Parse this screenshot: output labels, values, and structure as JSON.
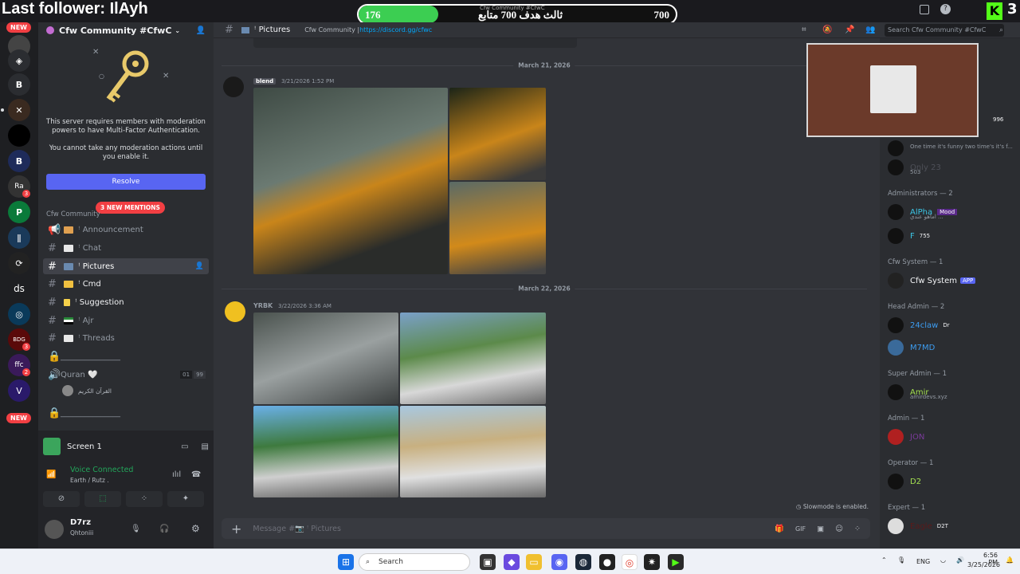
{
  "stream": {
    "last_follower": "Last follower: IlAyh",
    "goal_current": "176",
    "goal_target": "700",
    "goal_fraction": 0.25,
    "goal_label": "ثالث هدف 700 متابع",
    "goal_caption": "Cfw Community #CfwC",
    "kick_count": "3"
  },
  "rail": {
    "new_badge_top": "NEW",
    "new_badge_bottom": "NEW",
    "ds_label": "ds",
    "servers": [
      "server-1",
      "server-2",
      "server-3",
      "server-4",
      "server-5",
      "server-6",
      "server-7",
      "server-8",
      "server-9",
      "server-10",
      "server-11",
      "server-12",
      "server-13",
      "server-14",
      "server-15"
    ],
    "badges": [
      "3",
      "3",
      "2",
      "3"
    ]
  },
  "server": {
    "name": "Cfw Community #CfwC",
    "mfa_text_1": "This server requires members with moderation powers to have Multi-Factor Authentication.",
    "mfa_text_2": "You cannot take any moderation actions until you enable it.",
    "resolve_label": "Resolve",
    "category": "Cfw Community",
    "mentions_badge": "3 NEW MENTIONS"
  },
  "channels": [
    {
      "name": "ꜝ Announcement",
      "icon": "megaphone-icon",
      "emoji": "pizza"
    },
    {
      "name": "ꜝ Chat",
      "icon": "hash-icon",
      "emoji": "page"
    },
    {
      "name": "ꜝ Pictures",
      "icon": "hash-icon",
      "emoji": "frame"
    },
    {
      "name": "ꜝ Cmd",
      "icon": "hash-icon",
      "emoji": "hand"
    },
    {
      "name": "ꜝ Suggestion",
      "icon": "hash-icon",
      "emoji": "bulb"
    },
    {
      "name": "ꜝ Ajr",
      "icon": "hash-icon",
      "emoji": "flag"
    },
    {
      "name": "ꜝ Threads",
      "icon": "hash-icon",
      "emoji": "page"
    },
    {
      "name": "_______________",
      "icon": "lock-icon",
      "emoji": ""
    },
    {
      "name": "Quran 🤍",
      "icon": "speaker-icon",
      "emoji": ""
    },
    {
      "name": "_______________",
      "icon": "lock-icon",
      "emoji": ""
    }
  ],
  "quran": {
    "count_a": "01",
    "count_b": "99",
    "listener": "القرآن الكريم"
  },
  "panel": {
    "screen": "Screen 1",
    "voice_status": "Voice Connected",
    "voice_channel": "Earth / Rutz .",
    "username": "D7rz",
    "user_status": "Qhtoniii"
  },
  "topbar": {
    "channel": "ꜝ Pictures",
    "topic_prefix": "Cfw Community | ",
    "topic_link": "https://discord.gg/cfwc",
    "search_placeholder": "Search Cfw Community #CfwC"
  },
  "messages": {
    "date1": "March 21, 2026",
    "date2": "March 22, 2026",
    "m1_author": "blend",
    "m1_time": "3/21/2026 1:52 PM",
    "m2_author": "YRBK",
    "m2_time": "3/22/2026 3:36 AM",
    "slowmode": "Slowmode is enabled.",
    "composer_placeholder": "Message #📷 ꜝ Pictures"
  },
  "members": {
    "count_996": "996",
    "m_top1_sub": "One time it's funny two time's it's f...",
    "m_top2": "Only 23",
    "m_top2_sub": "503",
    "groups": [
      {
        "title": "Administrators — 2",
        "members": [
          {
            "name": "AlPha",
            "sub": "اماهو عندي ...",
            "tag": "Mood"
          },
          {
            "name": "F",
            "sub": "",
            "tag": "755"
          }
        ]
      },
      {
        "title": "Cfw System — 1",
        "members": [
          {
            "name": "Cfw System",
            "sub": "",
            "tag": "APP"
          }
        ]
      },
      {
        "title": "Head Admin — 2",
        "members": [
          {
            "name": "24claw",
            "sub": "",
            "tag": "Dr"
          },
          {
            "name": "M7MD",
            "sub": "",
            "tag": ""
          }
        ]
      },
      {
        "title": "Super Admin — 1",
        "members": [
          {
            "name": "Amir",
            "sub": "amirdevs.xyz",
            "tag": ""
          }
        ]
      },
      {
        "title": "Admin — 1",
        "members": [
          {
            "name": "JON",
            "sub": "",
            "tag": ""
          }
        ]
      },
      {
        "title": "Operator — 1",
        "members": [
          {
            "name": "D2",
            "sub": "",
            "tag": ""
          }
        ]
      },
      {
        "title": "Expert — 1",
        "members": [
          {
            "name": "Eagle",
            "sub": "",
            "tag": "D2T"
          }
        ]
      }
    ]
  },
  "taskbar": {
    "search": "Search",
    "lang": "ENG",
    "time": "6:56 PM",
    "date": "3/25/2026"
  },
  "colors": {
    "blurple": "#5865f2",
    "green": "#3cce52",
    "red": "#f23f43"
  }
}
